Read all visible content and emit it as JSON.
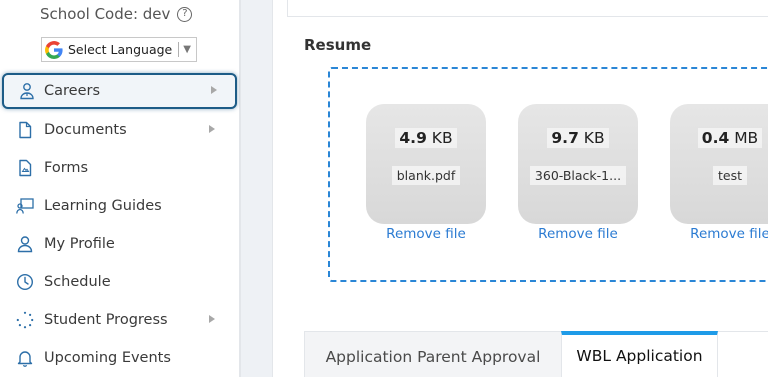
{
  "sidebar": {
    "school_code": "School Code: dev",
    "language_label": "Select Language",
    "items": [
      {
        "label": "Careers"
      },
      {
        "label": "Documents"
      },
      {
        "label": "Forms"
      },
      {
        "label": "Learning Guides"
      },
      {
        "label": "My Profile"
      },
      {
        "label": "Schedule"
      },
      {
        "label": "Student Progress"
      },
      {
        "label": "Upcoming Events"
      }
    ]
  },
  "main": {
    "resume_title": "Resume",
    "files": [
      {
        "size_value": "4.9",
        "size_unit": "KB",
        "name": "blank.pdf",
        "remove_label": "Remove file"
      },
      {
        "size_value": "9.7",
        "size_unit": "KB",
        "name": "360-Black-1...",
        "remove_label": "Remove file"
      },
      {
        "size_value": "0.4",
        "size_unit": "MB",
        "name": "test",
        "remove_label": "Remove file"
      }
    ],
    "tabs": [
      {
        "label": "Application Parent Approval"
      },
      {
        "label": "WBL Application"
      }
    ]
  },
  "colors": {
    "active_border": "#1d5c87",
    "link": "#2b7bd2",
    "dropzone_border": "#2a86d6",
    "active_tab": "#1e9be8"
  }
}
